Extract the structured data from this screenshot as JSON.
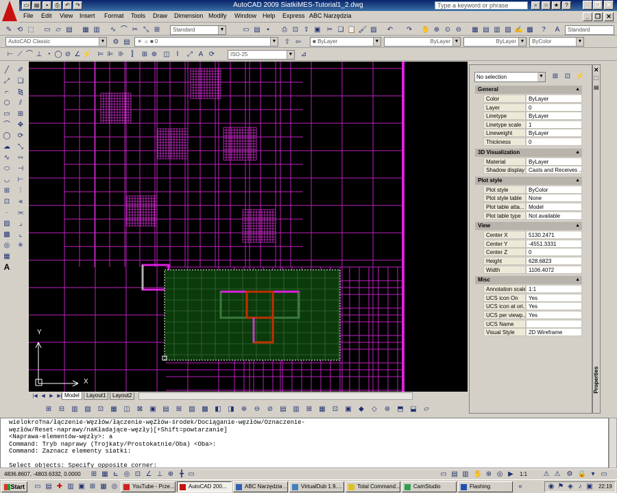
{
  "window": {
    "title": "AutoCAD 2009 SiatkiMES-Tutorial1_2.dwg",
    "help_search_placeholder": "Type a keyword or phrase"
  },
  "menu": [
    "File",
    "Edit",
    "View",
    "Insert",
    "Format",
    "Tools",
    "Draw",
    "Dimension",
    "Modify",
    "Window",
    "Help",
    "Express",
    "ABC Narzędzia"
  ],
  "toolbars": {
    "text_style": "Standard",
    "dim_style": "Standard",
    "workspace": "AutoCAD Classic",
    "layer": "0",
    "color": "ByLayer",
    "linetype": "ByLayer",
    "lineweight": "ByLayer",
    "plot_style": "ByColor",
    "dim_style_iso": "ISO-25"
  },
  "layout_tabs": [
    "Model",
    "Layout1",
    "Layout2"
  ],
  "ucs": {
    "y_label": "Y",
    "x_label": "X"
  },
  "properties": {
    "selection": "No selection",
    "panel_title": "Properties",
    "sections": [
      {
        "name": "General",
        "rows": [
          {
            "k": "Color",
            "v": "ByLayer"
          },
          {
            "k": "Layer",
            "v": "0"
          },
          {
            "k": "Linetype",
            "v": "ByLayer"
          },
          {
            "k": "Linetype scale",
            "v": "1"
          },
          {
            "k": "Lineweight",
            "v": "ByLayer"
          },
          {
            "k": "Thickness",
            "v": "0"
          }
        ]
      },
      {
        "name": "3D Visualization",
        "rows": [
          {
            "k": "Material",
            "v": "ByLayer"
          },
          {
            "k": "Shadow display",
            "v": "Casts and Receives ..."
          }
        ]
      },
      {
        "name": "Plot style",
        "rows": [
          {
            "k": "Plot style",
            "v": "ByColor"
          },
          {
            "k": "Plot style table",
            "v": "None"
          },
          {
            "k": "Plot table atta...",
            "v": "Model"
          },
          {
            "k": "Plot table type",
            "v": "Not available"
          }
        ]
      },
      {
        "name": "View",
        "rows": [
          {
            "k": "Center X",
            "v": "5130.2471"
          },
          {
            "k": "Center Y",
            "v": "-4551.3331"
          },
          {
            "k": "Center Z",
            "v": "0"
          },
          {
            "k": "Height",
            "v": "628.6823"
          },
          {
            "k": "Width",
            "v": "1106.4072"
          }
        ]
      },
      {
        "name": "Misc",
        "rows": [
          {
            "k": "Annotation scale",
            "v": "1:1"
          },
          {
            "k": "UCS icon On",
            "v": "Yes"
          },
          {
            "k": "UCS icon at ori...",
            "v": "Yes"
          },
          {
            "k": "UCS per viewp...",
            "v": "Yes"
          },
          {
            "k": "UCS Name",
            "v": ""
          },
          {
            "k": "Visual Style",
            "v": "2D Wireframe"
          }
        ]
      }
    ]
  },
  "command_line": [
    "wielokroTna/łączenie-Węzłów/łączenie-węZłów-środek/Dociąganie-węzłów/Oznaczenie-",
    "węzłów/Reset-naprawy/naKładające-węzły)[+Shift=powtarzanie]",
    "<Naprawa-elementów-węzły>: a",
    "Command: Tryb naprawy (Trojkaty/Prostokatnie/Oba) <Oba>:",
    "Command: Zaznacz elementy siatki:",
    "",
    "Select objects: Specify opposite corner:"
  ],
  "status": {
    "coords": "4836.8607, -4803.6332, 0.0000",
    "scale": "1:1"
  },
  "taskbar": {
    "start": "Start",
    "tasks": [
      "YouTube - Prze...",
      "AutoCAD 200...",
      "ABC Narzędzia ...",
      "VirtualDub 1.9....",
      "Total Command...",
      "CamStudio",
      "Flashing"
    ],
    "clock": "22:19"
  },
  "colors": {
    "grid": "#c020c0",
    "selection_fill": "#0b3a0b",
    "highlight_green": "#3c7a3c",
    "highlight_red": "#c03000"
  }
}
